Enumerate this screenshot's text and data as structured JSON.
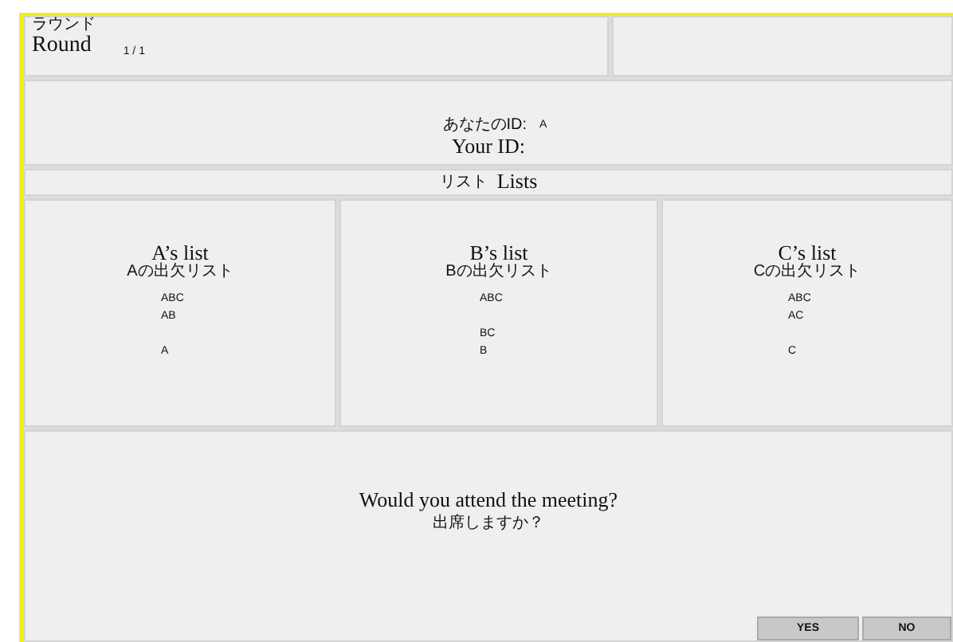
{
  "round": {
    "label_ja": "ラウンド",
    "label": "Round",
    "value": "1 / 1"
  },
  "your_id": {
    "label_ja": "あなたのID:",
    "value": "A",
    "label": "Your ID:"
  },
  "lists_header": {
    "label_ja": "リスト",
    "label": "Lists"
  },
  "lists": [
    {
      "title": "A’s list",
      "subtitle": "Aの出欠リスト",
      "entries": [
        {
          "text": "ABC",
          "gap_before": false
        },
        {
          "text": "AB",
          "gap_before": false
        },
        {
          "text": "A",
          "gap_before": true
        }
      ]
    },
    {
      "title": "B’s list",
      "subtitle": "Bの出欠リスト",
      "entries": [
        {
          "text": "ABC",
          "gap_before": false
        },
        {
          "text": "BC",
          "gap_before": true
        },
        {
          "text": "B",
          "gap_before": false
        }
      ]
    },
    {
      "title": "C’s list",
      "subtitle": "Cの出欠リスト",
      "entries": [
        {
          "text": "ABC",
          "gap_before": false
        },
        {
          "text": "AC",
          "gap_before": false
        },
        {
          "text": "C",
          "gap_before": true
        }
      ]
    }
  ],
  "question": {
    "text": "Would you attend the meeting?",
    "text_ja": "出席しますか？"
  },
  "buttons": [
    "YES",
    "NO"
  ]
}
